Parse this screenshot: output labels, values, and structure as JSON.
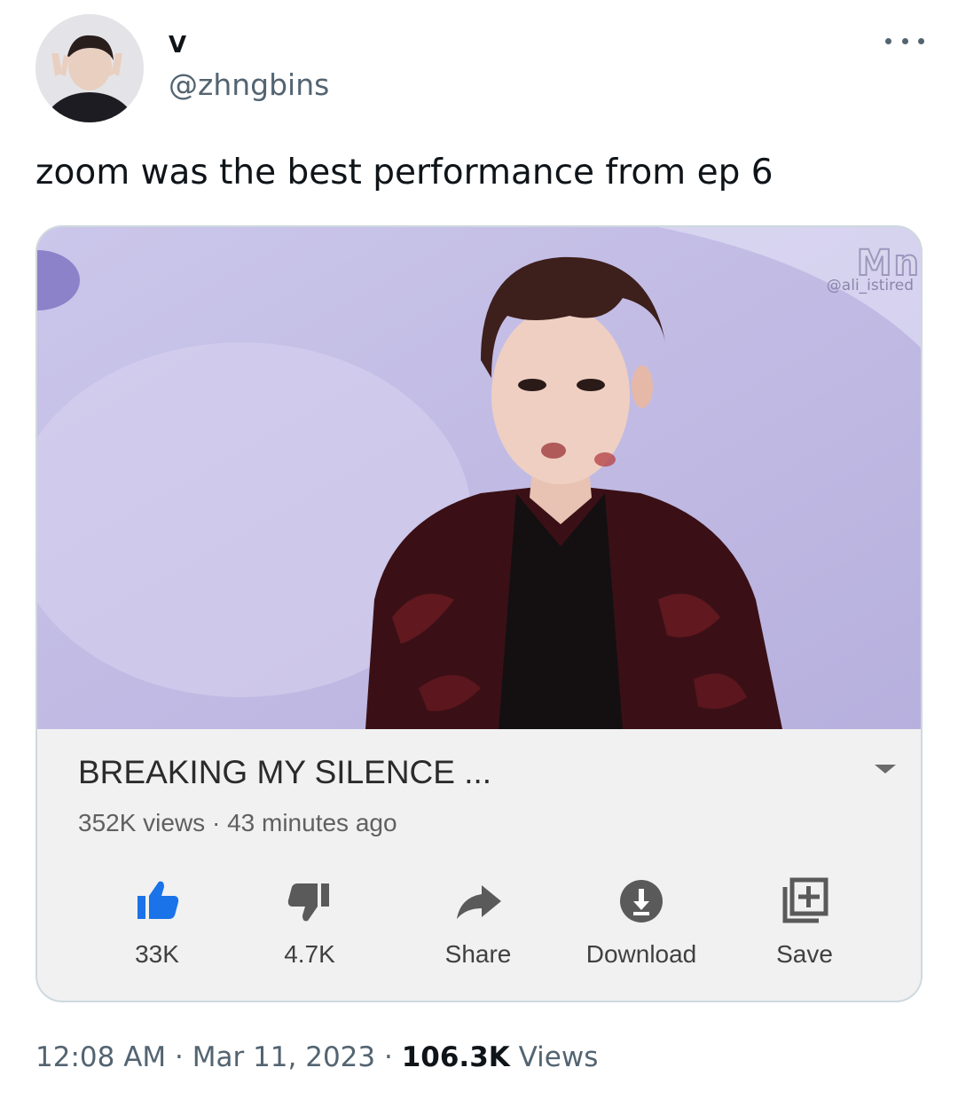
{
  "author": {
    "display_name": "V",
    "handle": "@zhngbins"
  },
  "tweet": {
    "text": "zoom was the best performance from ep 6"
  },
  "media": {
    "logo_text": "Mn",
    "watermark": "@ali_istired",
    "video_title": "BREAKING MY SILENCE ...",
    "views": "352K views",
    "meta_separator": "·",
    "uploaded": "43 minutes ago",
    "actions": [
      {
        "label": "33K",
        "icon": "thumbs-up-icon"
      },
      {
        "label": "4.7K",
        "icon": "thumbs-down-icon"
      },
      {
        "label": "Share",
        "icon": "share-arrow-icon"
      },
      {
        "label": "Download",
        "icon": "download-icon"
      },
      {
        "label": "Save",
        "icon": "save-playlist-icon"
      }
    ],
    "accent_color": "#1a73e8"
  },
  "footer": {
    "time": "12:08 AM",
    "date": "Mar 11, 2023",
    "separator": "·",
    "views_count": "106.3K",
    "views_label": "Views"
  }
}
